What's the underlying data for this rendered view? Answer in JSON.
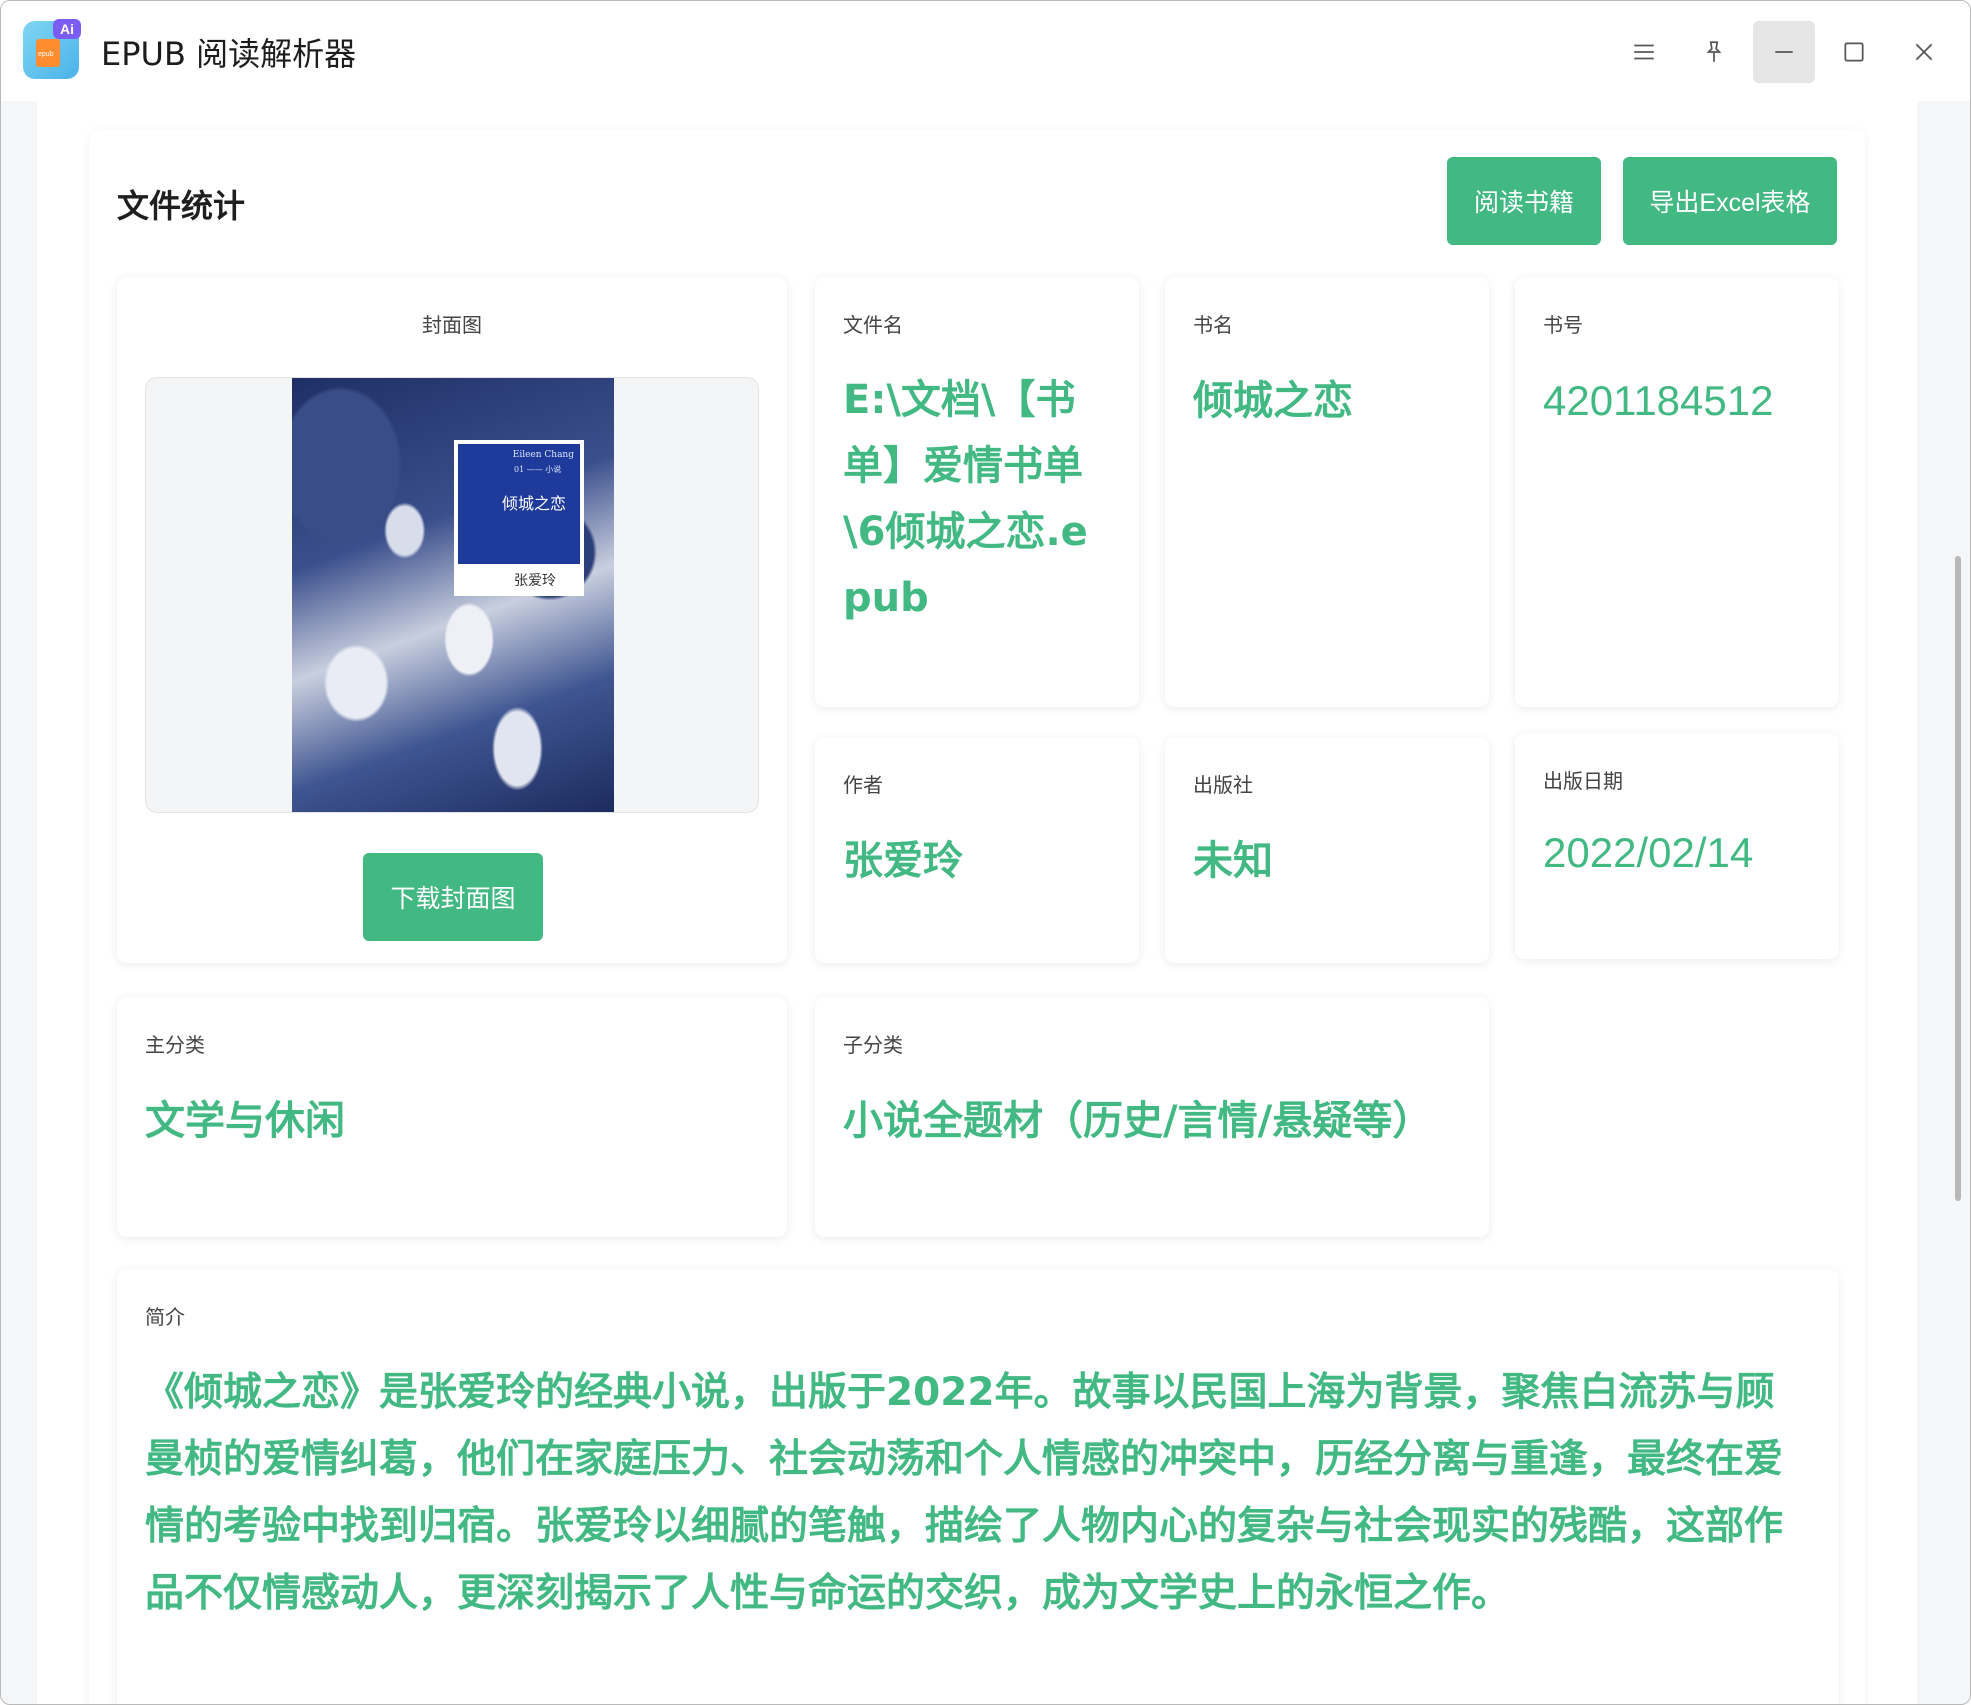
{
  "app": {
    "title": "EPUB 阅读解析器",
    "logo_badge": "Ai",
    "logo_doc": "epub"
  },
  "panel": {
    "title": "文件统计",
    "read_button": "阅读书籍",
    "export_button": "导出Excel表格"
  },
  "cover": {
    "label": "封面图",
    "download_button": "下载封面图",
    "art_author": "Eileen Chang",
    "art_number": "01 —— 小说",
    "art_title": "倾城之恋",
    "art_signature": "张爱玲"
  },
  "fields": {
    "filename": {
      "label": "文件名",
      "value": "E:\\文档\\【书单】爱情书单\\6倾城之恋.epub"
    },
    "bookname": {
      "label": "书名",
      "value": "倾城之恋"
    },
    "bookid": {
      "label": "书号",
      "value": "4201184512"
    },
    "author": {
      "label": "作者",
      "value": "张爱玲"
    },
    "publisher": {
      "label": "出版社",
      "value": "未知"
    },
    "pubdate": {
      "label": "出版日期",
      "value": "2022/02/14"
    },
    "maincat": {
      "label": "主分类",
      "value": "文学与休闲"
    },
    "subcat": {
      "label": "子分类",
      "value": "小说全题材（历史/言情/悬疑等）"
    },
    "intro": {
      "label": "简介",
      "value": "《倾城之恋》是张爱玲的经典小说，出版于2022年。故事以民国上海为背景，聚焦白流苏与顾曼桢的爱情纠葛，他们在家庭压力、社会动荡和个人情感的冲突中，历经分离与重逢，最终在爱情的考验中找到归宿。张爱玲以细腻的笔触，描绘了人物内心的复杂与社会现实的残酷，这部作品不仅情感动人，更深刻揭示了人性与命运的交织，成为文学史上的永恒之作。"
    }
  },
  "colors": {
    "accent": "#42b883",
    "cover_blue": "#1e3a9a"
  },
  "icons": {
    "menu": "menu-icon",
    "pin": "pin-icon",
    "minimize": "minimize-icon",
    "maximize": "maximize-icon",
    "close": "close-icon"
  }
}
